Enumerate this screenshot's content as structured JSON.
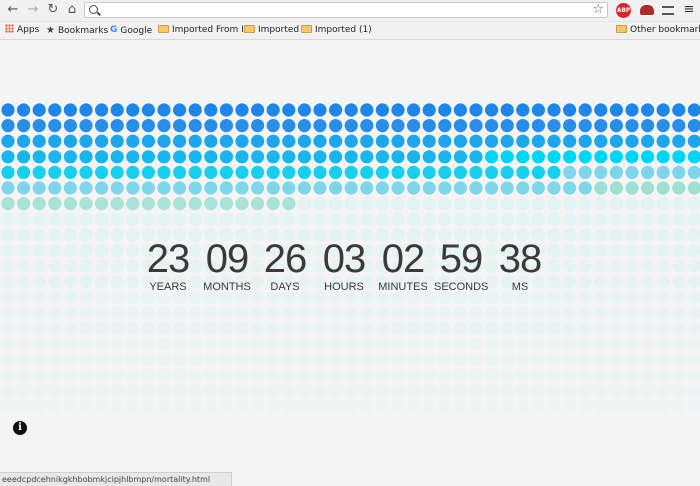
{
  "browser": {
    "address_value": "",
    "buttons": {
      "back": "←",
      "forward": "→",
      "reload": "↻",
      "home": "⌂",
      "star": "☆",
      "menu": "≡"
    },
    "extensions": {
      "abp": "ABP"
    },
    "bookmarks": [
      "Apps",
      "Bookmarks",
      "Google",
      "Imported From IE",
      "Imported",
      "Imported (1)"
    ],
    "other_bookmarks": "Other bookmarks",
    "status_url": "eeedcpdcehnikgkhbobmkjcipjhlbmpn/mortality.html"
  },
  "timer": {
    "units": [
      {
        "value": "23",
        "label": "YEARS"
      },
      {
        "value": "09",
        "label": "MONTHS"
      },
      {
        "value": "26",
        "label": "DAYS"
      },
      {
        "value": "03",
        "label": "HOURS"
      },
      {
        "value": "02",
        "label": "MINUTES"
      },
      {
        "value": "59",
        "label": "SECONDS"
      },
      {
        "value": "38",
        "label": "MS"
      }
    ]
  },
  "info_icon": "i",
  "dot_grid": {
    "columns": 45,
    "rows": 20,
    "filled_rows": 6,
    "partial_row_filled": 19,
    "colors": {
      "row_colors": [
        "#1f86e8",
        "#2a8ee8",
        "#1ea6ea",
        "#19b6ee",
        "#19cfee",
        "#7fd6ea"
      ],
      "partial": "#a8e2d8",
      "empty": "#e3f2f2",
      "highlight_cyan": "#00d6f2",
      "highlight_mint": "#9fe0d2"
    }
  }
}
